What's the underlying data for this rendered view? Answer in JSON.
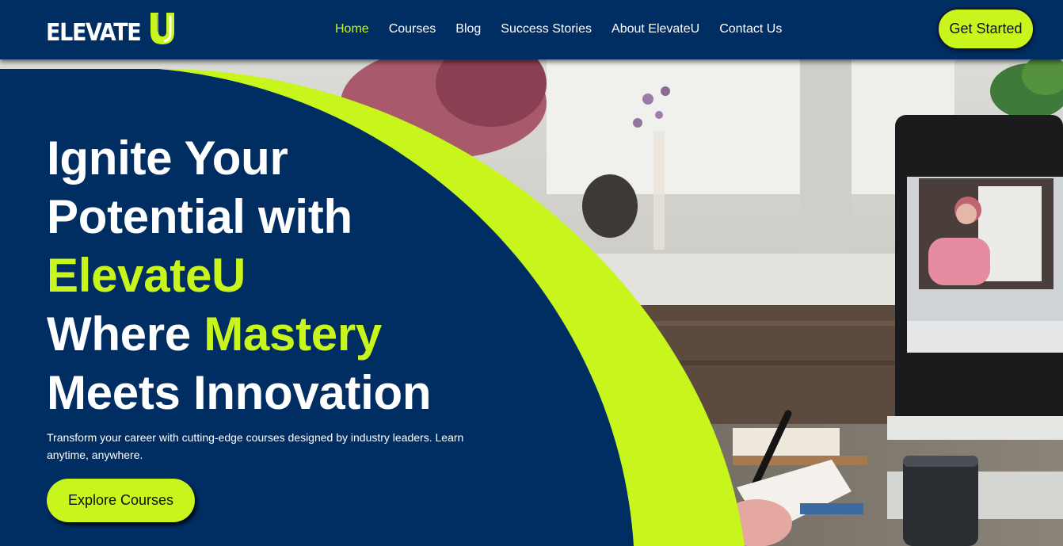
{
  "brand": {
    "logo_text": "ELEVATE",
    "logo_letter": "U",
    "colors": {
      "navy": "#002d62",
      "lime": "#c8f51c",
      "white": "#ffffff"
    }
  },
  "nav": {
    "items": [
      {
        "label": "Home",
        "active": true
      },
      {
        "label": "Courses",
        "active": false
      },
      {
        "label": "Blog",
        "active": false
      },
      {
        "label": "Success Stories",
        "active": false
      },
      {
        "label": "About ElevateU",
        "active": false
      },
      {
        "label": "Contact Us",
        "active": false
      }
    ],
    "cta_label": "Get Started"
  },
  "hero": {
    "headline": {
      "line1": "Ignite Your",
      "line2": "Potential with",
      "line3_accent": "ElevateU",
      "line4_prefix": "Where ",
      "line4_accent": "Mastery",
      "line5": "Meets Innovation"
    },
    "subtitle": "Transform your career with cutting-edge courses designed by industry leaders. Learn anytime, anywhere.",
    "cta_label": "Explore Courses",
    "image_icon": "workspace-photo"
  }
}
